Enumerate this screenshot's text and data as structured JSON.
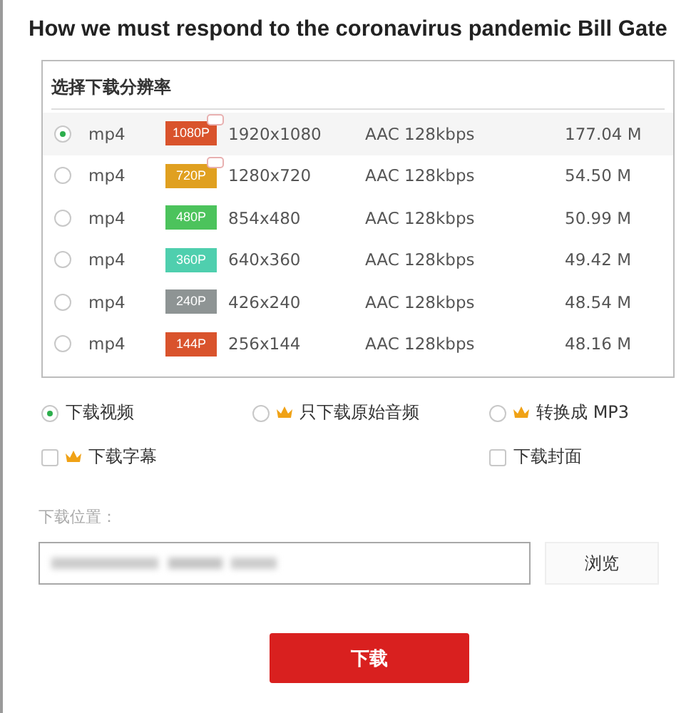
{
  "title": "How we must respond to the coronavirus pandemic  Bill Gate",
  "resolution_panel": {
    "heading": "选择下载分辨率",
    "rows": [
      {
        "selected": true,
        "format": "mp4",
        "badge": "1080P",
        "color": "#d9532c",
        "premium": true,
        "resolution": "1920x1080",
        "audio": "AAC 128kbps",
        "size": "177.04 M"
      },
      {
        "selected": false,
        "format": "mp4",
        "badge": "720P",
        "color": "#e0a020",
        "premium": true,
        "resolution": "1280x720",
        "audio": "AAC 128kbps",
        "size": "54.50 M"
      },
      {
        "selected": false,
        "format": "mp4",
        "badge": "480P",
        "color": "#4cc35c",
        "premium": false,
        "resolution": "854x480",
        "audio": "AAC 128kbps",
        "size": "50.99 M"
      },
      {
        "selected": false,
        "format": "mp4",
        "badge": "360P",
        "color": "#4fcfae",
        "premium": false,
        "resolution": "640x360",
        "audio": "AAC 128kbps",
        "size": "49.42 M"
      },
      {
        "selected": false,
        "format": "mp4",
        "badge": "240P",
        "color": "#8e9494",
        "premium": false,
        "resolution": "426x240",
        "audio": "AAC 128kbps",
        "size": "48.54 M"
      },
      {
        "selected": false,
        "format": "mp4",
        "badge": "144P",
        "color": "#d9532c",
        "premium": false,
        "resolution": "256x144",
        "audio": "AAC 128kbps",
        "size": "48.16 M"
      }
    ]
  },
  "options": [
    {
      "kind": "radio",
      "selected": true,
      "premium": false,
      "label": "下载视频"
    },
    {
      "kind": "radio",
      "selected": false,
      "premium": true,
      "label": "只下载原始音频"
    },
    {
      "kind": "radio",
      "selected": false,
      "premium": true,
      "label": "转换成 MP3"
    },
    {
      "kind": "checkbox",
      "checked": false,
      "premium": true,
      "label": "下载字幕"
    },
    {
      "kind": "spacer"
    },
    {
      "kind": "checkbox",
      "checked": false,
      "premium": false,
      "label": "下载封面"
    }
  ],
  "location": {
    "label": "下载位置：",
    "browse_button": "浏览"
  },
  "download_button": "下载"
}
